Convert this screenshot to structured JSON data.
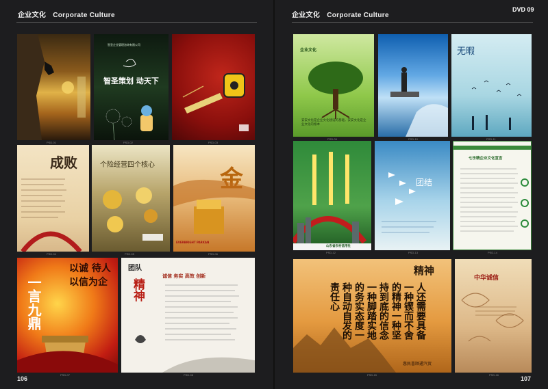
{
  "left_page": {
    "section_zh": "企业文化",
    "section_en": "Corporate Culture",
    "page_number": "106"
  },
  "right_page": {
    "section_zh": "企业文化",
    "section_en": "Corporate Culture",
    "page_number": "107",
    "badge": "DVD 09"
  },
  "posters": {
    "p1": {
      "caption": "PSD-01"
    },
    "p2": {
      "company": "智圣企业管理咨询有限公司",
      "slogan": "智圣策划 动天下",
      "caption": "PSD-02"
    },
    "p3": {
      "caption": "PSD-03"
    },
    "p4": {
      "title": "成败",
      "caption": "PSD-04"
    },
    "p5": {
      "title": "个险经营四个核心",
      "caption": "PSD-05"
    },
    "p6": {
      "title": "金",
      "brand": "EVERBRIGHT PARKAN",
      "caption": "PSD-06"
    },
    "p7": {
      "left_text": "一言九鼎",
      "right_text": "以诚 待人 以信为企",
      "caption": "PSD-07"
    },
    "p8": {
      "team": "团队",
      "motto": "诚信 务实 高效 创新",
      "spirit": "精神",
      "caption": "PSD-08"
    },
    "p9": {
      "title": "企业文化",
      "text": "安安文化是企业文化建设的基础，安安文化是企业文化的根本",
      "caption": "PSD-09"
    },
    "p10": {
      "caption": "PSD-10"
    },
    "p11": {
      "title": "无暇",
      "caption": "PSD-11"
    },
    "p12": {
      "bank": "山东省农村信用社",
      "caption": "PSD-12"
    },
    "p13": {
      "title": "团结",
      "caption": "PSD-13"
    },
    "p14": {
      "title": "七乐精企业文化宣言",
      "caption": "PSD-14"
    },
    "p15": {
      "title": "精神",
      "lines": [
        "人还需要具备",
        "一种锲而不舍",
        "的精神一种坚",
        "持到底的信念",
        "一种脚踏实地",
        "的务实态度一",
        "种自动自发的",
        "责任心"
      ],
      "footer": "惠民喜顺通汽贸",
      "caption": "PSD-15"
    },
    "p16": {
      "title": "中华诚信",
      "caption": "PSD-16"
    }
  }
}
